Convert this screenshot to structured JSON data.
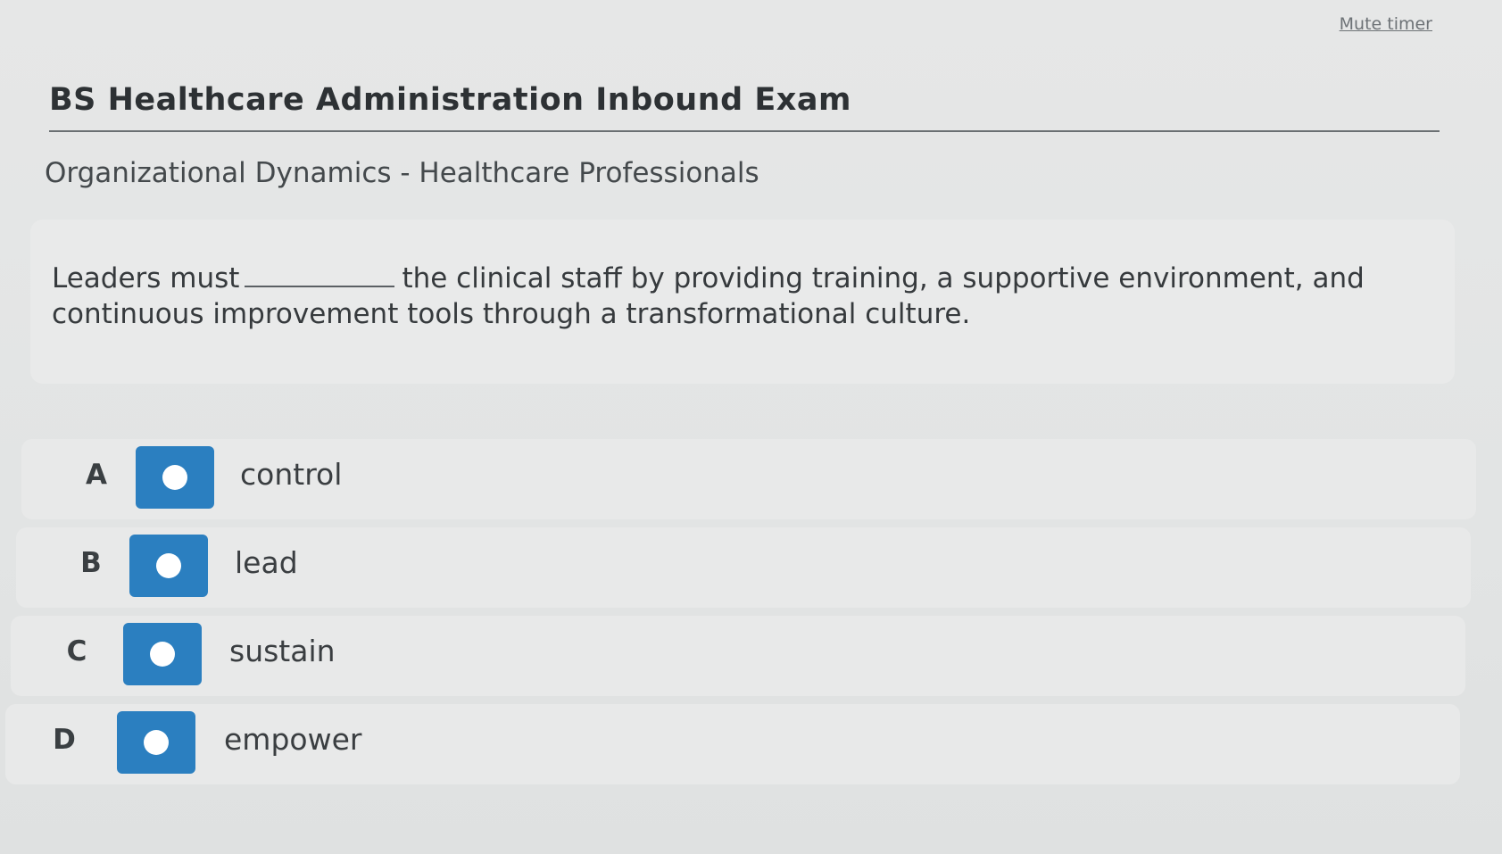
{
  "header": {
    "mute_timer_label": "Mute timer"
  },
  "exam": {
    "title": "BS Healthcare Administration Inbound Exam",
    "section": "Organizational Dynamics - Healthcare Professionals"
  },
  "question": {
    "text_before_blank": "Leaders must",
    "text_after_blank": "the clinical staff by providing training, a supportive environment, and continuous improvement tools through a transformational culture."
  },
  "options": [
    {
      "letter": "A",
      "label": "control",
      "selected": false
    },
    {
      "letter": "B",
      "label": "lead",
      "selected": false
    },
    {
      "letter": "C",
      "label": "sustain",
      "selected": false
    },
    {
      "letter": "D",
      "label": "empower",
      "selected": false
    }
  ],
  "colors": {
    "radio_button": "#2b7fc0",
    "background": "#e4e6e6"
  }
}
